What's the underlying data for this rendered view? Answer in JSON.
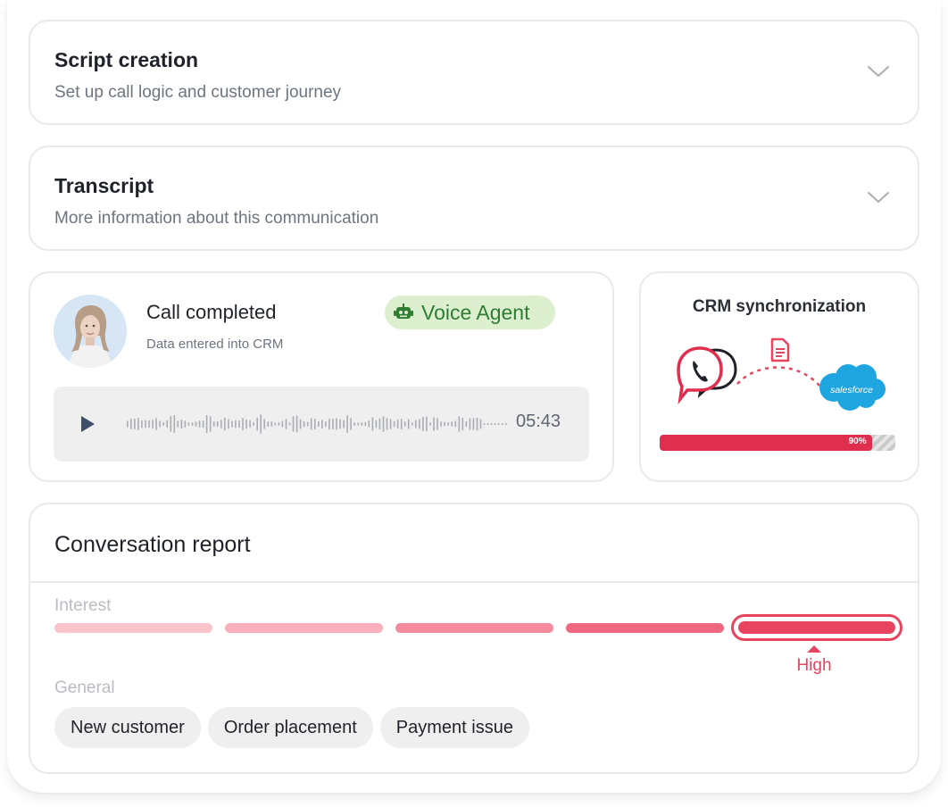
{
  "accordion": [
    {
      "title": "Script creation",
      "subtitle": "Set up call logic and customer journey"
    },
    {
      "title": "Transcript",
      "subtitle": "More information about this communication"
    }
  ],
  "call": {
    "title": "Call completed",
    "subtitle": "Data entered into CRM",
    "badge": "Voice Agent",
    "duration": "05:43"
  },
  "crm": {
    "title": "CRM synchronization",
    "salesforce_logo": "salesforce",
    "progress": 0.9,
    "progress_label": "90%"
  },
  "report": {
    "title": "Conversation report",
    "interest_label": "Interest",
    "interest_level_index": 4,
    "interest_level_text": "High",
    "general_label": "General",
    "tags": [
      "New customer",
      "Order placement",
      "Payment issue"
    ]
  },
  "colors": {
    "accent": "#e8445f",
    "badge_bg": "#dcefcf",
    "badge_text": "#2e7d32",
    "progress": "#e02e4e",
    "salesforce": "#1fa5e0"
  },
  "icons": {
    "accordion": "chevron-down-icon",
    "badge": "robot-icon",
    "play": "play-icon",
    "document": "document-icon",
    "phone": "phone-chat-icon"
  }
}
